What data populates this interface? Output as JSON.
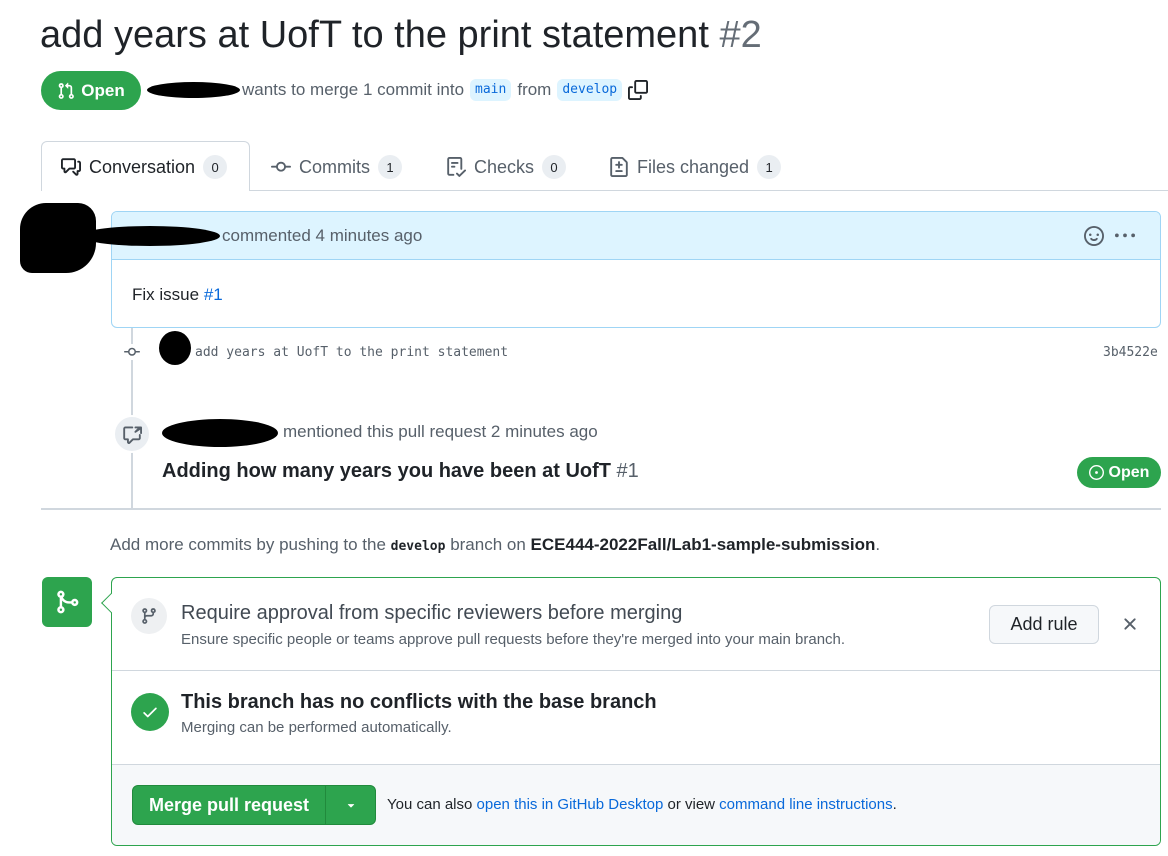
{
  "pr": {
    "title": "add years at UofT to the print statement",
    "number": "#2",
    "state": "Open",
    "merge_text_1": "wants to merge 1 commit into",
    "base_branch": "main",
    "from_text": "from",
    "head_branch": "develop"
  },
  "tabs": [
    {
      "label": "Conversation",
      "count": "0",
      "icon": "comment-discussion-icon"
    },
    {
      "label": "Commits",
      "count": "1",
      "icon": "git-commit-icon"
    },
    {
      "label": "Checks",
      "count": "0",
      "icon": "checklist-icon"
    },
    {
      "label": "Files changed",
      "count": "1",
      "icon": "file-diff-icon"
    }
  ],
  "comment": {
    "header": "commented 4 minutes ago",
    "body_text": "Fix issue",
    "body_link": "#1"
  },
  "commit": {
    "message": "add years at UofT to the print statement",
    "sha": "3b4522e"
  },
  "mention": {
    "text": "mentioned this pull request 2 minutes ago",
    "ref_title": "Adding how many years you have been at UofT",
    "ref_number": "#1",
    "ref_state": "Open"
  },
  "push_hint": {
    "prefix": "Add more commits by pushing to the",
    "branch": "develop",
    "middle": "branch on",
    "repo": "ECE444-2022Fall/Lab1-sample-submission",
    "suffix": "."
  },
  "merge": {
    "rule_title": "Require approval from specific reviewers before merging",
    "rule_sub": "Ensure specific people or teams approve pull requests before they're merged into your main branch.",
    "add_rule_label": "Add rule",
    "conflicts_title": "This branch has no conflicts with the base branch",
    "conflicts_sub": "Merging can be performed automatically.",
    "merge_button": "Merge pull request",
    "alt_prefix": "You can also",
    "alt_link1": "open this in GitHub Desktop",
    "alt_middle": "or view",
    "alt_link2": "command line instructions",
    "alt_suffix": "."
  },
  "colors": {
    "open_green": "#2da44e",
    "link_blue": "#0969da",
    "comment_header_bg": "#ddf4ff"
  }
}
